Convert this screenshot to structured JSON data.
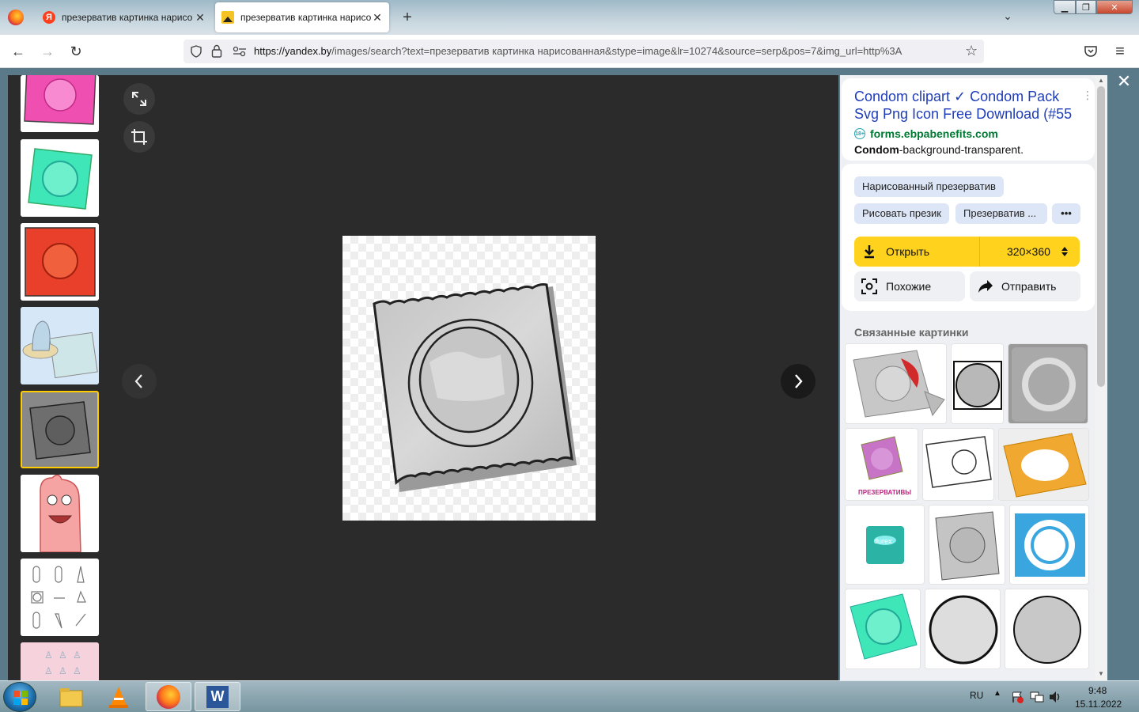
{
  "browser": {
    "tabs": [
      {
        "title": "презерватив картинка нарисо",
        "favicon": "yandex-favicon",
        "active": false
      },
      {
        "title": "презерватив картинка нарисо",
        "favicon": "image-favicon",
        "active": true
      }
    ],
    "new_tab_label": "+",
    "url_host": "https://yandex.by",
    "url_rest": "/images/search?text=презерватив картинка нарисованная&stype=image&lr=10274&source=serp&pos=7&img_url=http%3A"
  },
  "sidebar": {
    "result_title": "Condom clipart ✓ Condom Pack Svg Png Icon Free Download (#55",
    "age_badge": "18+",
    "domain": "forms.ebpabenefits.com",
    "description_bold": "Condom",
    "description_rest": "-background-transparent.",
    "tags": [
      "Нарисованный презерватив",
      "Рисовать презик",
      "Презерватив ..."
    ],
    "more_label": "•••",
    "open_label": "Открыть",
    "size_label": "320×360",
    "similar_label": "Похожие",
    "share_label": "Отправить",
    "related_title": "Связанные картинки",
    "related_caption": "ПРЕЗЕРВАТИВЫ"
  },
  "taskbar": {
    "lang": "RU",
    "time": "9:48",
    "date": "15.11.2022"
  },
  "colors": {
    "accent_yellow": "#ffd21e",
    "link_blue": "#1f3db8",
    "domain_green": "#007a33",
    "viewer_bg": "#2b2b2b"
  }
}
